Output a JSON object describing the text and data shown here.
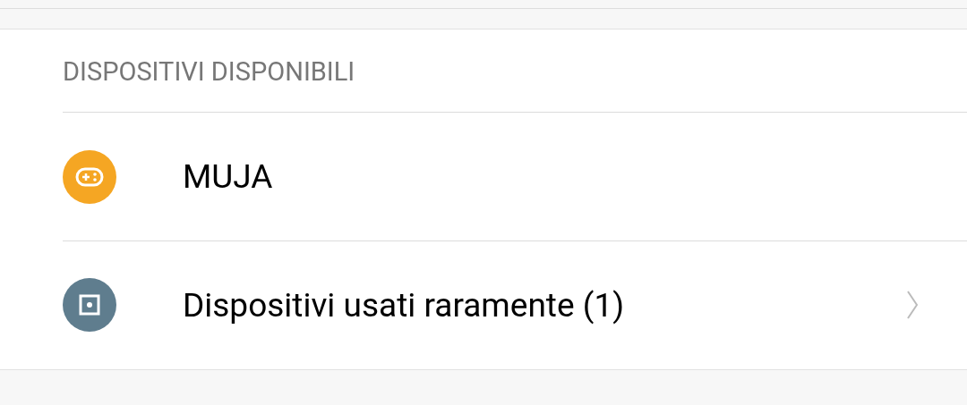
{
  "section": {
    "title": "DISPOSITIVI DISPONIBILI",
    "items": [
      {
        "kind": "gamepad",
        "label": "MUJA",
        "color": "#f5a623",
        "chevron": false
      },
      {
        "kind": "device",
        "label": "Dispositivi usati raramente (1)",
        "color": "#5f7d8e",
        "chevron": true
      }
    ]
  }
}
